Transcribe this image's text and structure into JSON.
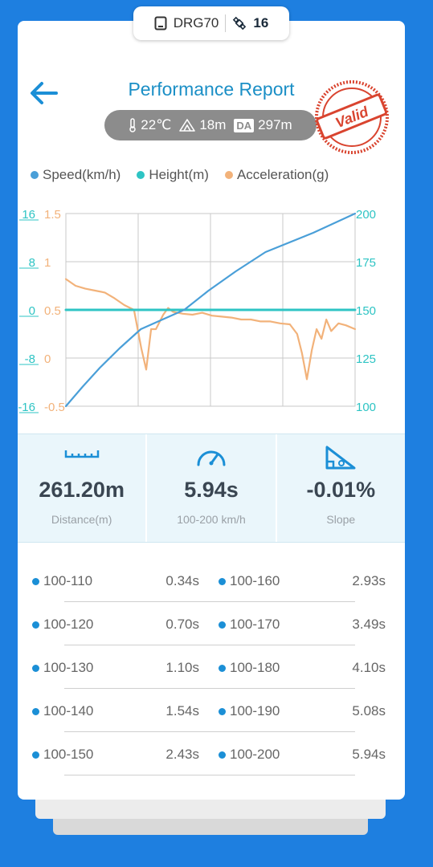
{
  "device": {
    "name": "DRG70",
    "satellites": "16"
  },
  "header": {
    "title": "Performance Report",
    "stamp": "Valid"
  },
  "conditions": {
    "temperature": "22℃",
    "altitude": "18m",
    "da_label": "DA",
    "density_altitude": "297m"
  },
  "legend": [
    {
      "label": "Speed(km/h)",
      "color": "#4a9fd8"
    },
    {
      "label": "Height(m)",
      "color": "#2ec4c4"
    },
    {
      "label": "Acceleration(g)",
      "color": "#f2b27a"
    }
  ],
  "chart_data": {
    "type": "line",
    "x_range": [
      0,
      5.94
    ],
    "grid": true,
    "axes": {
      "height": {
        "ticks": [
          "16",
          "8",
          "0",
          "-8",
          "-16"
        ],
        "range": [
          -16,
          16
        ],
        "color": "#2ec4c4"
      },
      "acceleration": {
        "ticks": [
          "1.5",
          "1",
          "0.5",
          "0",
          "-0.5"
        ],
        "range": [
          -0.5,
          1.5
        ],
        "color": "#f2b27a"
      },
      "speed": {
        "ticks": [
          "200",
          "175",
          "150",
          "125",
          "100"
        ],
        "range": [
          100,
          200
        ],
        "color": "#2ec4c4"
      }
    },
    "series": [
      {
        "name": "Speed(km/h)",
        "axis": "speed",
        "color": "#4a9fd8",
        "x": [
          0,
          0.34,
          0.7,
          1.1,
          1.54,
          2.43,
          2.93,
          3.49,
          4.1,
          5.08,
          5.94
        ],
        "y": [
          100,
          110,
          120,
          130,
          140,
          150,
          160,
          170,
          180,
          190,
          200
        ]
      },
      {
        "name": "Height(m)",
        "axis": "height",
        "color": "#2ec4c4",
        "x": [
          0,
          5.94
        ],
        "y": [
          0,
          0
        ]
      },
      {
        "name": "Acceleration(g)",
        "axis": "acceleration",
        "color": "#f2b27a",
        "x": [
          0,
          0.2,
          0.4,
          0.6,
          0.8,
          1.0,
          1.2,
          1.4,
          1.55,
          1.65,
          1.75,
          1.85,
          2.0,
          2.1,
          2.2,
          2.4,
          2.6,
          2.8,
          3.0,
          3.2,
          3.4,
          3.6,
          3.8,
          4.0,
          4.2,
          4.4,
          4.6,
          4.75,
          4.85,
          4.95,
          5.05,
          5.15,
          5.25,
          5.35,
          5.45,
          5.6,
          5.75,
          5.94
        ],
        "y": [
          0.82,
          0.75,
          0.72,
          0.7,
          0.68,
          0.62,
          0.55,
          0.5,
          0.1,
          -0.12,
          0.3,
          0.3,
          0.45,
          0.52,
          0.48,
          0.46,
          0.45,
          0.47,
          0.44,
          0.43,
          0.42,
          0.4,
          0.4,
          0.38,
          0.38,
          0.36,
          0.35,
          0.25,
          0.05,
          -0.22,
          0.08,
          0.3,
          0.2,
          0.4,
          0.28,
          0.36,
          0.34,
          0.3
        ]
      }
    ]
  },
  "stats": [
    {
      "value": "261.20m",
      "label": "Distance(m)",
      "icon": "ruler-icon"
    },
    {
      "value": "5.94s",
      "label": "100-200 km/h",
      "icon": "speedometer-icon"
    },
    {
      "value": "-0.01%",
      "label": "Slope",
      "icon": "slope-icon"
    }
  ],
  "splits_left": [
    {
      "range": "100-110",
      "time": "0.34s"
    },
    {
      "range": "100-120",
      "time": "0.70s"
    },
    {
      "range": "100-130",
      "time": "1.10s"
    },
    {
      "range": "100-140",
      "time": "1.54s"
    },
    {
      "range": "100-150",
      "time": "2.43s"
    }
  ],
  "splits_right": [
    {
      "range": "100-160",
      "time": "2.93s"
    },
    {
      "range": "100-170",
      "time": "3.49s"
    },
    {
      "range": "100-180",
      "time": "4.10s"
    },
    {
      "range": "100-190",
      "time": "5.08s"
    },
    {
      "range": "100-200",
      "time": "5.94s"
    }
  ]
}
